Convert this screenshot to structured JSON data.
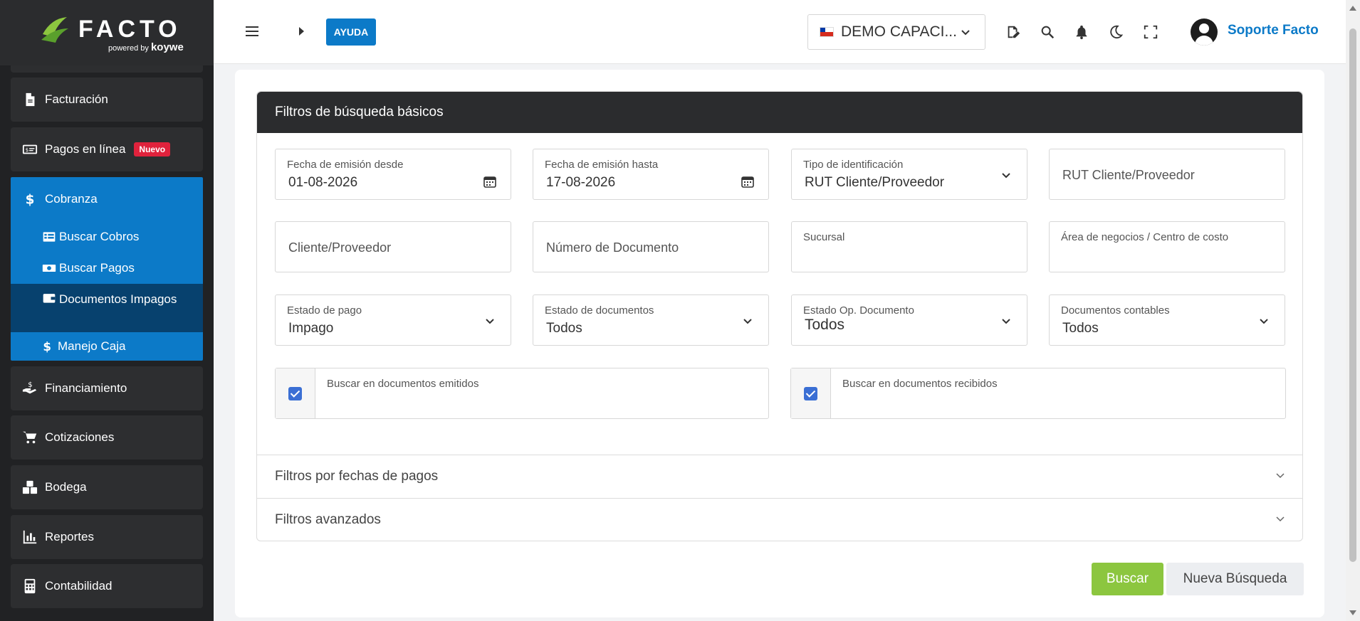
{
  "logo": {
    "text": "FACTO",
    "powered": "powered by",
    "brand": "koywe"
  },
  "sidebar": {
    "items": [
      {
        "label": "Facturación"
      },
      {
        "label": "Pagos en línea",
        "badge": "Nuevo"
      },
      {
        "label": "Financiamiento"
      },
      {
        "label": "Cotizaciones"
      },
      {
        "label": "Bodega"
      },
      {
        "label": "Reportes"
      },
      {
        "label": "Contabilidad"
      }
    ],
    "cobranza": {
      "label": "Cobranza",
      "subitems": [
        {
          "label": "Buscar Cobros"
        },
        {
          "label": "Buscar Pagos"
        },
        {
          "label": "Documentos Impagos"
        },
        {
          "label": "Manejo Caja"
        }
      ]
    }
  },
  "header": {
    "help_label": "AYUDA",
    "company": "DEMO CAPACI...",
    "user": "Soporte Facto"
  },
  "panel": {
    "title": "Filtros de búsqueda básicos",
    "fields": {
      "fecha_desde": {
        "label": "Fecha de emisión desde",
        "value": "01-08-2026"
      },
      "fecha_hasta": {
        "label": "Fecha de emisión hasta",
        "value": "17-08-2026"
      },
      "tipo_id": {
        "label": "Tipo de identificación",
        "value": "RUT Cliente/Proveedor"
      },
      "rut": {
        "placeholder": "RUT Cliente/Proveedor"
      },
      "cliente": {
        "placeholder": "Cliente/Proveedor"
      },
      "numero_doc": {
        "placeholder": "Número de Documento"
      },
      "sucursal": {
        "label": "Sucursal"
      },
      "area": {
        "label": "Área de negocios / Centro de costo"
      },
      "estado_pago": {
        "label": "Estado de pago",
        "value": "Impago"
      },
      "estado_docs": {
        "label": "Estado de documentos",
        "value": "Todos"
      },
      "estado_op": {
        "label": "Estado Op. Documento",
        "value": "Todos"
      },
      "docs_contables": {
        "label": "Documentos contables",
        "value": "Todos"
      },
      "emitidos": {
        "label": "Buscar en documentos emitidos",
        "checked": true
      },
      "recibidos": {
        "label": "Buscar en documentos recibidos",
        "checked": true
      }
    },
    "accordions": [
      {
        "label": "Filtros por fechas de pagos"
      },
      {
        "label": "Filtros avanzados"
      }
    ]
  },
  "actions": {
    "search": "Buscar",
    "new_search": "Nueva Búsqueda"
  },
  "colors": {
    "primary": "#0c7ac8",
    "sidebar": "#212224",
    "active_sub": "#07416e",
    "success": "#8cc63f",
    "badge": "#e0223c"
  }
}
